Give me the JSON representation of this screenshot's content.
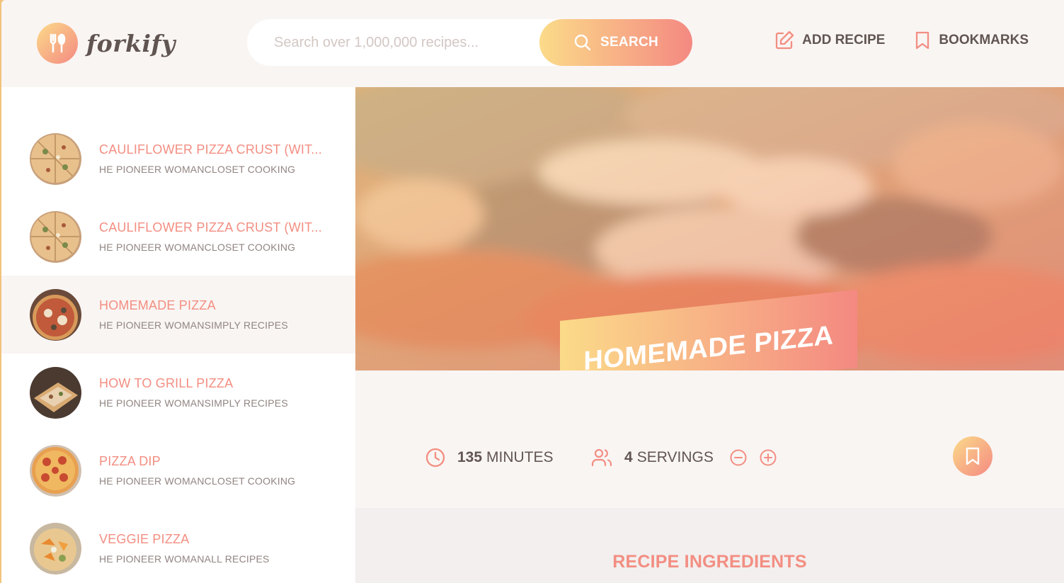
{
  "header": {
    "logo_text": "forkify",
    "search": {
      "placeholder": "Search over 1,000,000 recipes...",
      "button_label": "SEARCH"
    },
    "nav": {
      "add_recipe": "ADD RECIPE",
      "bookmarks": "BOOKMARKS"
    }
  },
  "results": [
    {
      "title": "CAULIFLOWER PIZZA CRUST (WIT...",
      "publisher": "HE PIONEER WOMANCLOSET COOKING",
      "active": false
    },
    {
      "title": "CAULIFLOWER PIZZA CRUST (WIT...",
      "publisher": "HE PIONEER WOMANCLOSET COOKING",
      "active": false
    },
    {
      "title": "HOMEMADE PIZZA",
      "publisher": "HE PIONEER WOMANSIMPLY RECIPES",
      "active": true
    },
    {
      "title": "HOW TO GRILL PIZZA",
      "publisher": "HE PIONEER WOMANSIMPLY RECIPES",
      "active": false
    },
    {
      "title": "PIZZA DIP",
      "publisher": "HE PIONEER WOMANCLOSET COOKING",
      "active": false
    },
    {
      "title": "VEGGIE PIZZA",
      "publisher": "HE PIONEER WOMANALL RECIPES",
      "active": false
    }
  ],
  "recipe": {
    "title": "HOMEMADE PIZZA",
    "minutes": "135",
    "minutes_label": "MINUTES",
    "servings": "4",
    "servings_label": "SERVINGS",
    "ingredients_heading": "RECIPE INGREDIENTS"
  },
  "colors": {
    "accent": "#f38e82",
    "gradient_start": "#fbdb89",
    "gradient_end": "#f48982",
    "text": "#615551"
  },
  "icons": [
    "fork-knife-icon",
    "search-icon",
    "edit-icon",
    "bookmark-icon",
    "clock-icon",
    "users-icon",
    "minus-circle-icon",
    "plus-circle-icon"
  ]
}
